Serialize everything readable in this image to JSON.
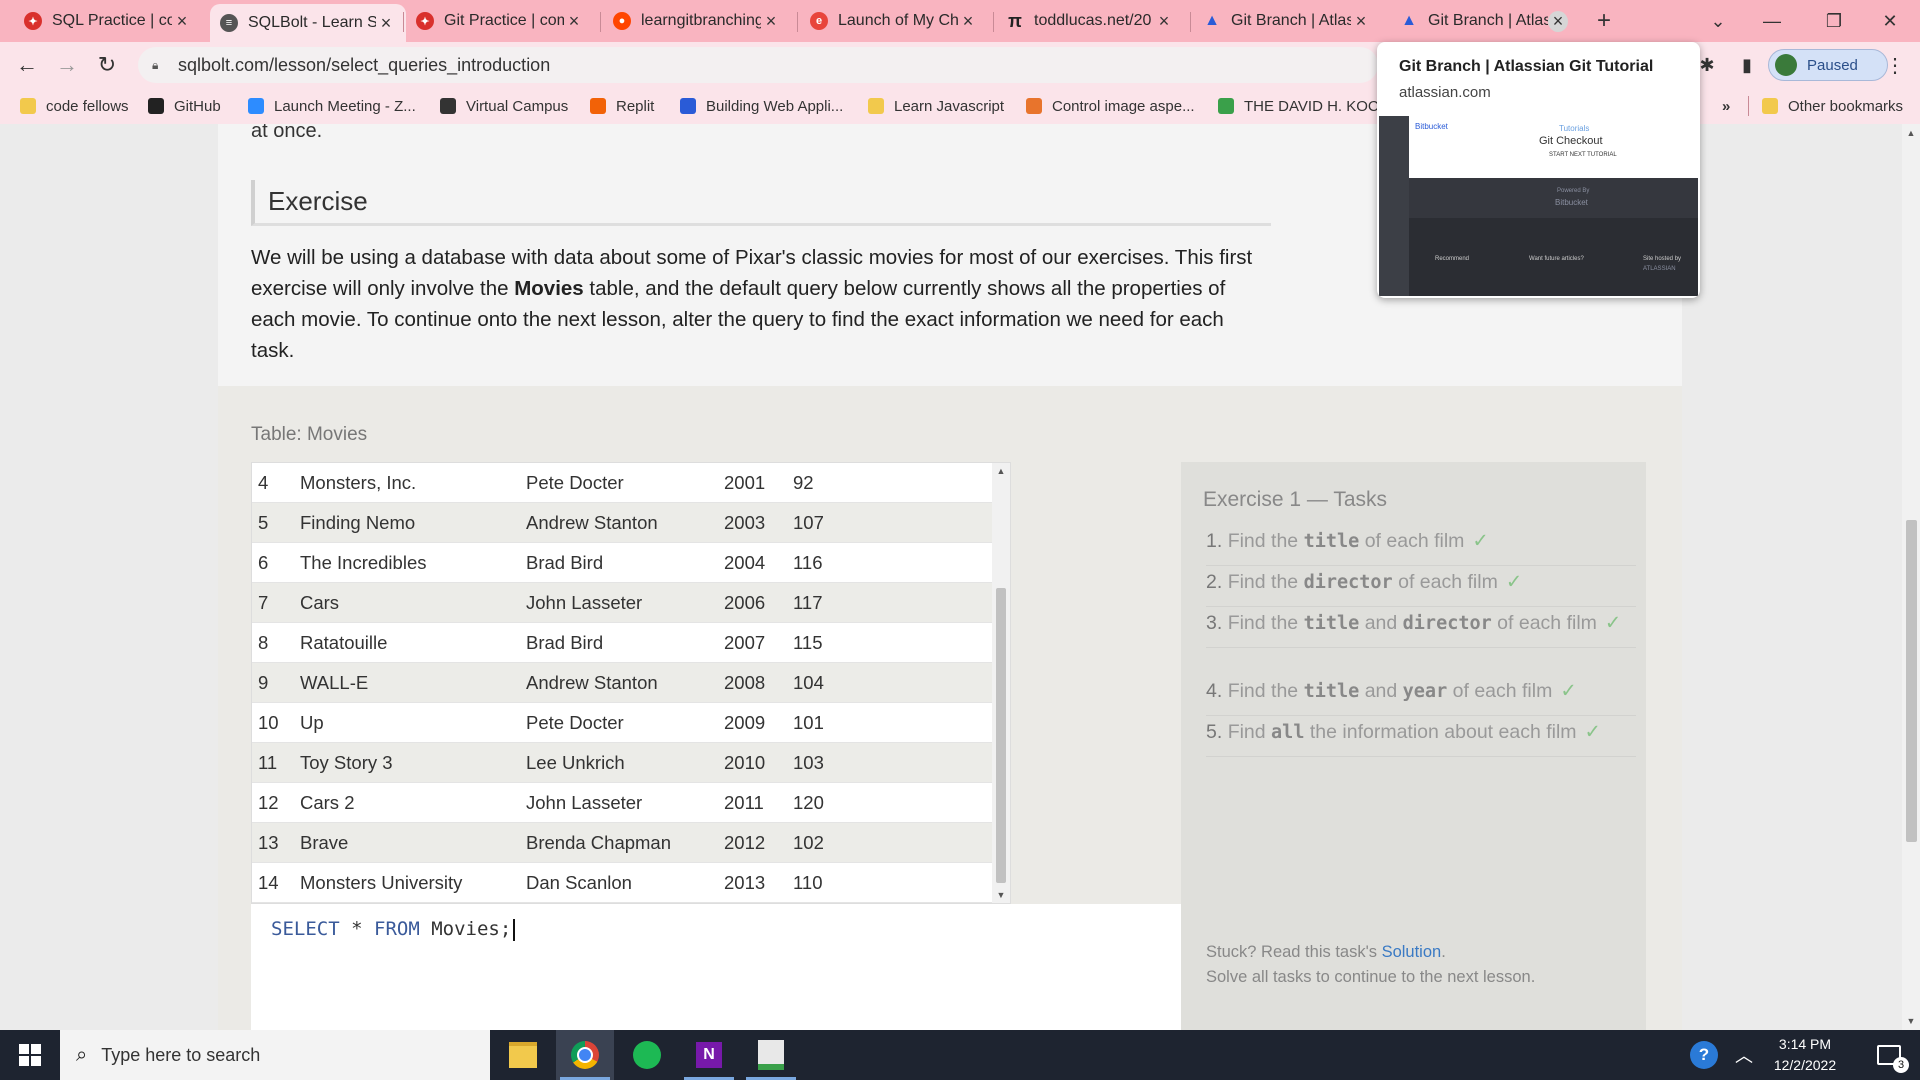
{
  "tabs": [
    {
      "label": "SQL Practice | con",
      "icon_color": "#d9302c",
      "icon": "shield-icon"
    },
    {
      "label": "SQLBolt - Learn S",
      "icon_color": "#555555",
      "icon": "db-icon"
    },
    {
      "label": "Git Practice | com",
      "icon_color": "#d9302c",
      "icon": "shield-icon"
    },
    {
      "label": "learngitbranching",
      "icon_color": "#ff4500",
      "icon": "reddit-icon"
    },
    {
      "label": "Launch of My Che",
      "icon_color": "#e8453c",
      "icon": "launch-icon"
    },
    {
      "label": "toddlucas.net/20",
      "icon_color": "#222222",
      "icon": "pi-icon"
    },
    {
      "label": "Git Branch | Atlas",
      "icon_color": "#2a5bd7",
      "icon": "atlassian-icon"
    },
    {
      "label": "Git Branch | Atlas",
      "icon_color": "#2a5bd7",
      "icon": "atlassian-icon"
    }
  ],
  "new_tab_label": "+",
  "address": {
    "url": "sqlbolt.com/lesson/select_queries_introduction"
  },
  "profile": {
    "label": "Paused"
  },
  "bookmarks": [
    {
      "label": "code fellows",
      "color": "#f2c94c"
    },
    {
      "label": "GitHub",
      "color": "#222222"
    },
    {
      "label": "Launch Meeting - Z...",
      "color": "#2d8cff"
    },
    {
      "label": "Virtual Campus",
      "color": "#333333"
    },
    {
      "label": "Replit",
      "color": "#f26207"
    },
    {
      "label": "Building Web Appli...",
      "color": "#2a5bd7"
    },
    {
      "label": "Learn Javascript",
      "color": "#f2c94c"
    },
    {
      "label": "Control image aspe...",
      "color": "#e8742c"
    },
    {
      "label": "THE DAVID H. KOC...",
      "color": "#3aa04a"
    }
  ],
  "bookmarks_more": "»",
  "other_bookmarks": "Other bookmarks",
  "hover_card": {
    "title": "Git Branch | Atlassian Git Tutorial",
    "domain": "atlassian.com",
    "thumb_logo": "Bitbucket",
    "thumb_tutorials": "Tutorials",
    "thumb_heading": "Git Checkout",
    "thumb_next": "START NEXT TUTORIAL",
    "thumb_powered": "Powered By",
    "thumb_footer_logo": "Bitbucket",
    "thumb_recommend": "Recommend",
    "thumb_future": "Want future articles?",
    "thumb_site": "Site hosted by",
    "thumb_atlassian": "ATLASSIAN"
  },
  "article": {
    "top_line": "at once.",
    "exercise_heading": "Exercise",
    "intro_before": "We will be using a database with data about some of Pixar's classic movies for most of our exercises. This first exercise will only involve the ",
    "intro_bold": "Movies",
    "intro_after": " table, and the default query below currently shows all the properties of each movie. To continue onto the next lesson, alter the query to find the exact information we need for each task."
  },
  "table": {
    "label": "Table: Movies",
    "rows": [
      [
        "4",
        "Monsters, Inc.",
        "Pete Docter",
        "2001",
        "92"
      ],
      [
        "5",
        "Finding Nemo",
        "Andrew Stanton",
        "2003",
        "107"
      ],
      [
        "6",
        "The Incredibles",
        "Brad Bird",
        "2004",
        "116"
      ],
      [
        "7",
        "Cars",
        "John Lasseter",
        "2006",
        "117"
      ],
      [
        "8",
        "Ratatouille",
        "Brad Bird",
        "2007",
        "115"
      ],
      [
        "9",
        "WALL-E",
        "Andrew Stanton",
        "2008",
        "104"
      ],
      [
        "10",
        "Up",
        "Pete Docter",
        "2009",
        "101"
      ],
      [
        "11",
        "Toy Story 3",
        "Lee Unkrich",
        "2010",
        "103"
      ],
      [
        "12",
        "Cars 2",
        "John Lasseter",
        "2011",
        "120"
      ],
      [
        "13",
        "Brave",
        "Brenda Chapman",
        "2012",
        "102"
      ],
      [
        "14",
        "Monsters University",
        "Dan Scanlon",
        "2013",
        "110"
      ]
    ]
  },
  "query": {
    "kw1": "SELECT",
    "star": "*",
    "kw2": "FROM",
    "table": "Movies;"
  },
  "tasks": {
    "title": "Exercise 1 — Tasks",
    "items": [
      {
        "num": "1.",
        "parts": [
          "Find the ",
          "title",
          " of each film"
        ]
      },
      {
        "num": "2.",
        "parts": [
          "Find the ",
          "director",
          " of each film"
        ]
      },
      {
        "num": "3.",
        "parts": [
          "Find the ",
          "title",
          " and ",
          "director",
          " of each film"
        ]
      },
      {
        "num": "4.",
        "parts": [
          "Find the ",
          "title",
          " and ",
          "year",
          " of each film"
        ]
      },
      {
        "num": "5.",
        "parts": [
          "Find ",
          "all",
          " the information about each film"
        ]
      }
    ],
    "check": "✓",
    "stuck_prefix": "Stuck? Read this task's ",
    "solution_link": "Solution",
    "stuck_suffix": ".",
    "continue_text": "Solve all tasks to continue to the next lesson.",
    "accent": "#3bb54a"
  },
  "taskbar": {
    "search_placeholder": "Type here to search",
    "time": "3:14 PM",
    "date": "12/2/2022",
    "notification_count": "3"
  }
}
